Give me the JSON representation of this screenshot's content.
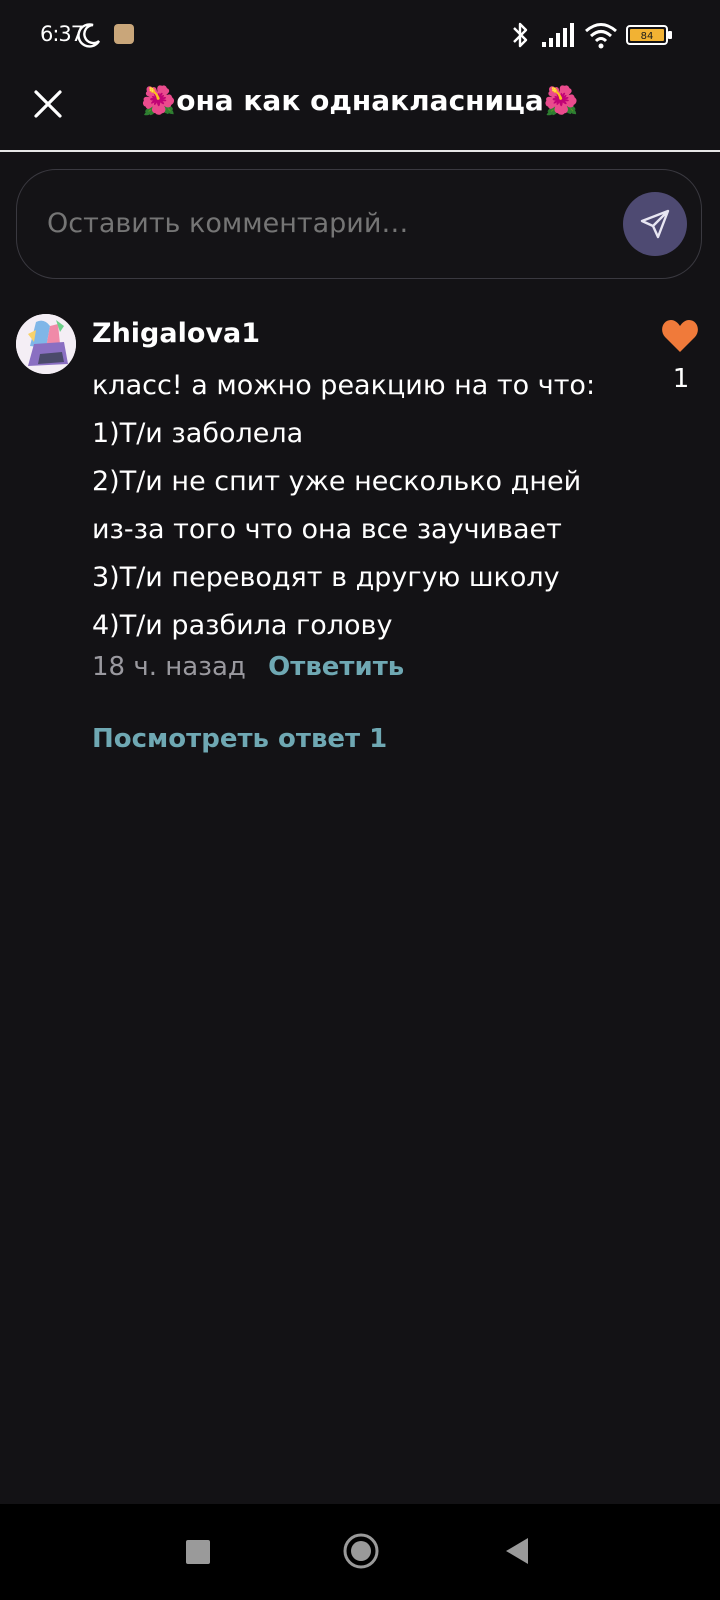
{
  "status_bar": {
    "time": "6:37",
    "battery": "84"
  },
  "header": {
    "title": "🌺она как однакласница🌺"
  },
  "comment_input": {
    "placeholder": "Оставить комментарий…"
  },
  "comment": {
    "username": "Zhigalova1",
    "lines": [
      "класс! а можно реакцию на то что:",
      "1)Т/и заболела",
      "2)Т/и не спит уже несколько дней",
      "из-за того что она все заучивает",
      "3)Т/и переводят в другую школу",
      "4)Т/и разбила голову"
    ],
    "time_ago": "18 ч. назад",
    "reply_label": "Ответить",
    "like_count": "1",
    "view_replies": "Посмотреть ответ 1"
  },
  "colors": {
    "background": "#131215",
    "accent": "#6fa8b3",
    "like": "#f07a3a",
    "send_button": "#4e4a72"
  }
}
